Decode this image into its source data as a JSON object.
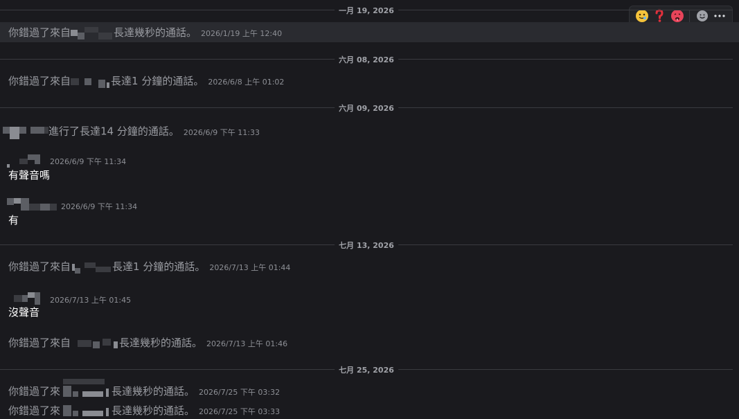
{
  "toolbar": {
    "reactions": [
      "slightly-smiling-face-icon",
      "red-question-mark-icon",
      "hot-face-icon"
    ],
    "add_reaction": "add-reaction-icon",
    "more": "more-options-icon"
  },
  "dates": [
    "一月 19, 2026",
    "六月 08, 2026",
    "六月 09, 2026",
    "七月 13, 2026",
    "七月 25, 2026"
  ],
  "messages": [
    {
      "type": "system",
      "prefix": "你錯過了來自",
      "suffix": "長達幾秒的通話。",
      "ts": "2026/1/19 上午 12:40"
    },
    {
      "type": "system",
      "prefix": "你錯過了來自",
      "suffix": "長達1 分鐘的通話。",
      "ts": "2026/6/8 上午 01:02"
    },
    {
      "type": "system",
      "prefix": "",
      "suffix": "進行了長達14 分鐘的通話。",
      "ts": "2026/6/9 下午 11:33"
    },
    {
      "type": "user",
      "ts": "2026/6/9 下午 11:34",
      "text": "有聲音嗎"
    },
    {
      "type": "user",
      "ts": "2026/6/9 下午 11:34",
      "text": "有"
    },
    {
      "type": "system",
      "prefix": "你錯過了來自",
      "suffix": "長達1 分鐘的通話。",
      "ts": "2026/7/13 上午 01:44"
    },
    {
      "type": "user",
      "ts": "2026/7/13 上午 01:45",
      "text": "沒聲音"
    },
    {
      "type": "system",
      "prefix": "你錯過了來自",
      "suffix": "長達幾秒的通話。",
      "ts": "2026/7/13 上午 01:46"
    },
    {
      "type": "system",
      "prefix": "你錯過了來",
      "suffix": "長達幾秒的通話。",
      "ts": "2026/7/25 下午 03:32"
    },
    {
      "type": "system",
      "prefix": "你錯過了來",
      "suffix": "長達幾秒的通話。",
      "ts": "2026/7/25 下午 03:33"
    }
  ]
}
